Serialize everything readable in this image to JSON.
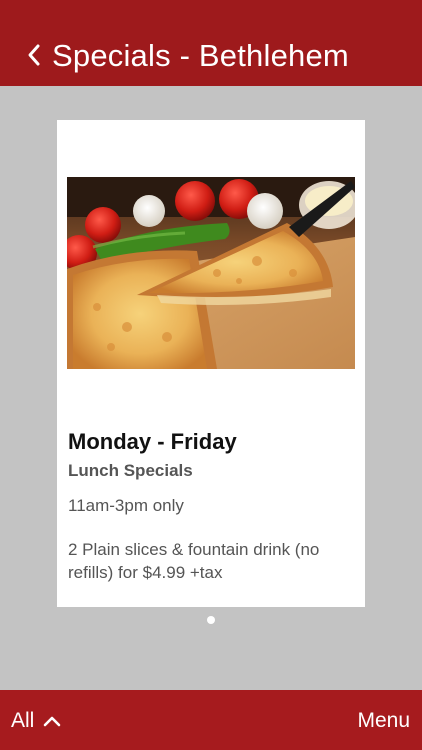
{
  "header": {
    "title": "Specials - Bethlehem",
    "back_icon": "chevron-left-icon",
    "background": "#9e1a1c"
  },
  "card": {
    "image_alt": "pizza-photo",
    "heading": "Monday - Friday",
    "subheading": "Lunch Specials",
    "hours": "11am-3pm only",
    "description": "2 Plain slices & fountain drink (no refills) for $4.99 +tax"
  },
  "pagination": {
    "current": 1,
    "total": 1
  },
  "footer": {
    "all_label": "All",
    "all_icon": "chevron-up-icon",
    "menu_label": "Menu",
    "background": "#a61b1e"
  }
}
